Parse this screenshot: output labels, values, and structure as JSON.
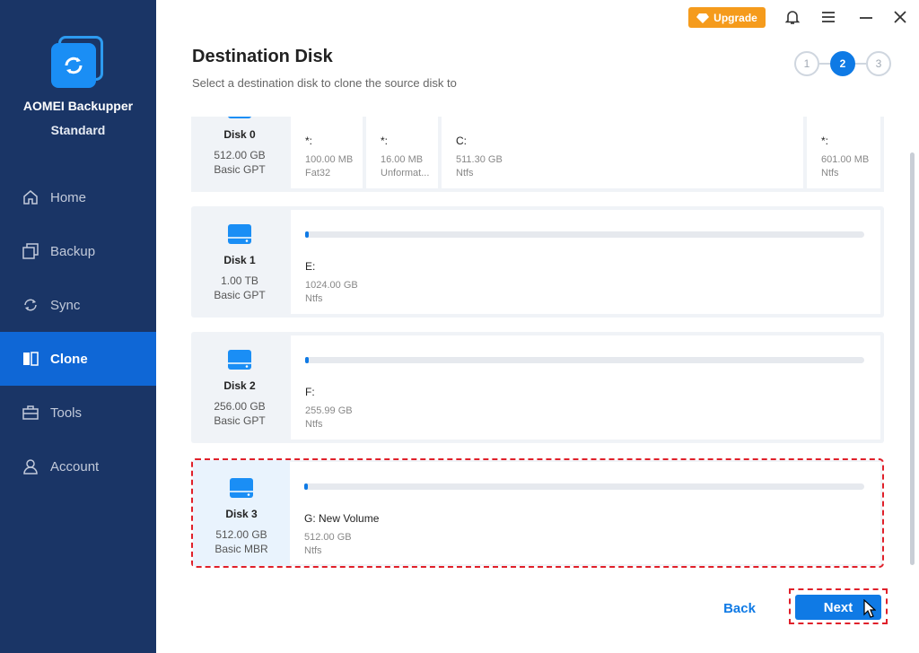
{
  "app": {
    "name": "AOMEI Backupper",
    "edition": "Standard"
  },
  "nav": [
    {
      "label": "Home",
      "icon": "home-icon",
      "active": false
    },
    {
      "label": "Backup",
      "icon": "backup-icon",
      "active": false
    },
    {
      "label": "Sync",
      "icon": "sync-icon",
      "active": false
    },
    {
      "label": "Clone",
      "icon": "clone-icon",
      "active": true
    },
    {
      "label": "Tools",
      "icon": "tools-icon",
      "active": false
    },
    {
      "label": "Account",
      "icon": "account-icon",
      "active": false
    }
  ],
  "topbar": {
    "upgrade_label": "Upgrade"
  },
  "page": {
    "title": "Destination Disk",
    "subtitle": "Select a destination disk to clone the source disk to"
  },
  "steps": [
    "1",
    "2",
    "3"
  ],
  "disk0": {
    "name": "Disk 0",
    "size": "512.00 GB",
    "type": "Basic GPT",
    "partitions": [
      {
        "label": "*:",
        "size": "100.00 MB",
        "fs": "Fat32"
      },
      {
        "label": "*:",
        "size": "16.00 MB",
        "fs": "Unformat..."
      },
      {
        "label": "C:",
        "size": "511.30 GB",
        "fs": "Ntfs"
      },
      {
        "label": "*:",
        "size": "601.00 MB",
        "fs": "Ntfs"
      }
    ]
  },
  "disks": [
    {
      "name": "Disk 1",
      "size": "1.00 TB",
      "type": "Basic GPT",
      "partition": {
        "label": "E:",
        "size": "1024.00 GB",
        "fs": "Ntfs"
      }
    },
    {
      "name": "Disk 2",
      "size": "256.00 GB",
      "type": "Basic GPT",
      "partition": {
        "label": "F:",
        "size": "255.99 GB",
        "fs": "Ntfs"
      }
    },
    {
      "name": "Disk 3",
      "size": "512.00 GB",
      "type": "Basic MBR",
      "partition": {
        "label": "G: New Volume",
        "size": "512.00 GB",
        "fs": "Ntfs"
      }
    }
  ],
  "buttons": {
    "back": "Back",
    "next": "Next"
  },
  "colors": {
    "sidebar": "#1a3566",
    "accent": "#0f7ae5",
    "upgrade": "#f59b1c",
    "highlight": "#e0202a"
  }
}
